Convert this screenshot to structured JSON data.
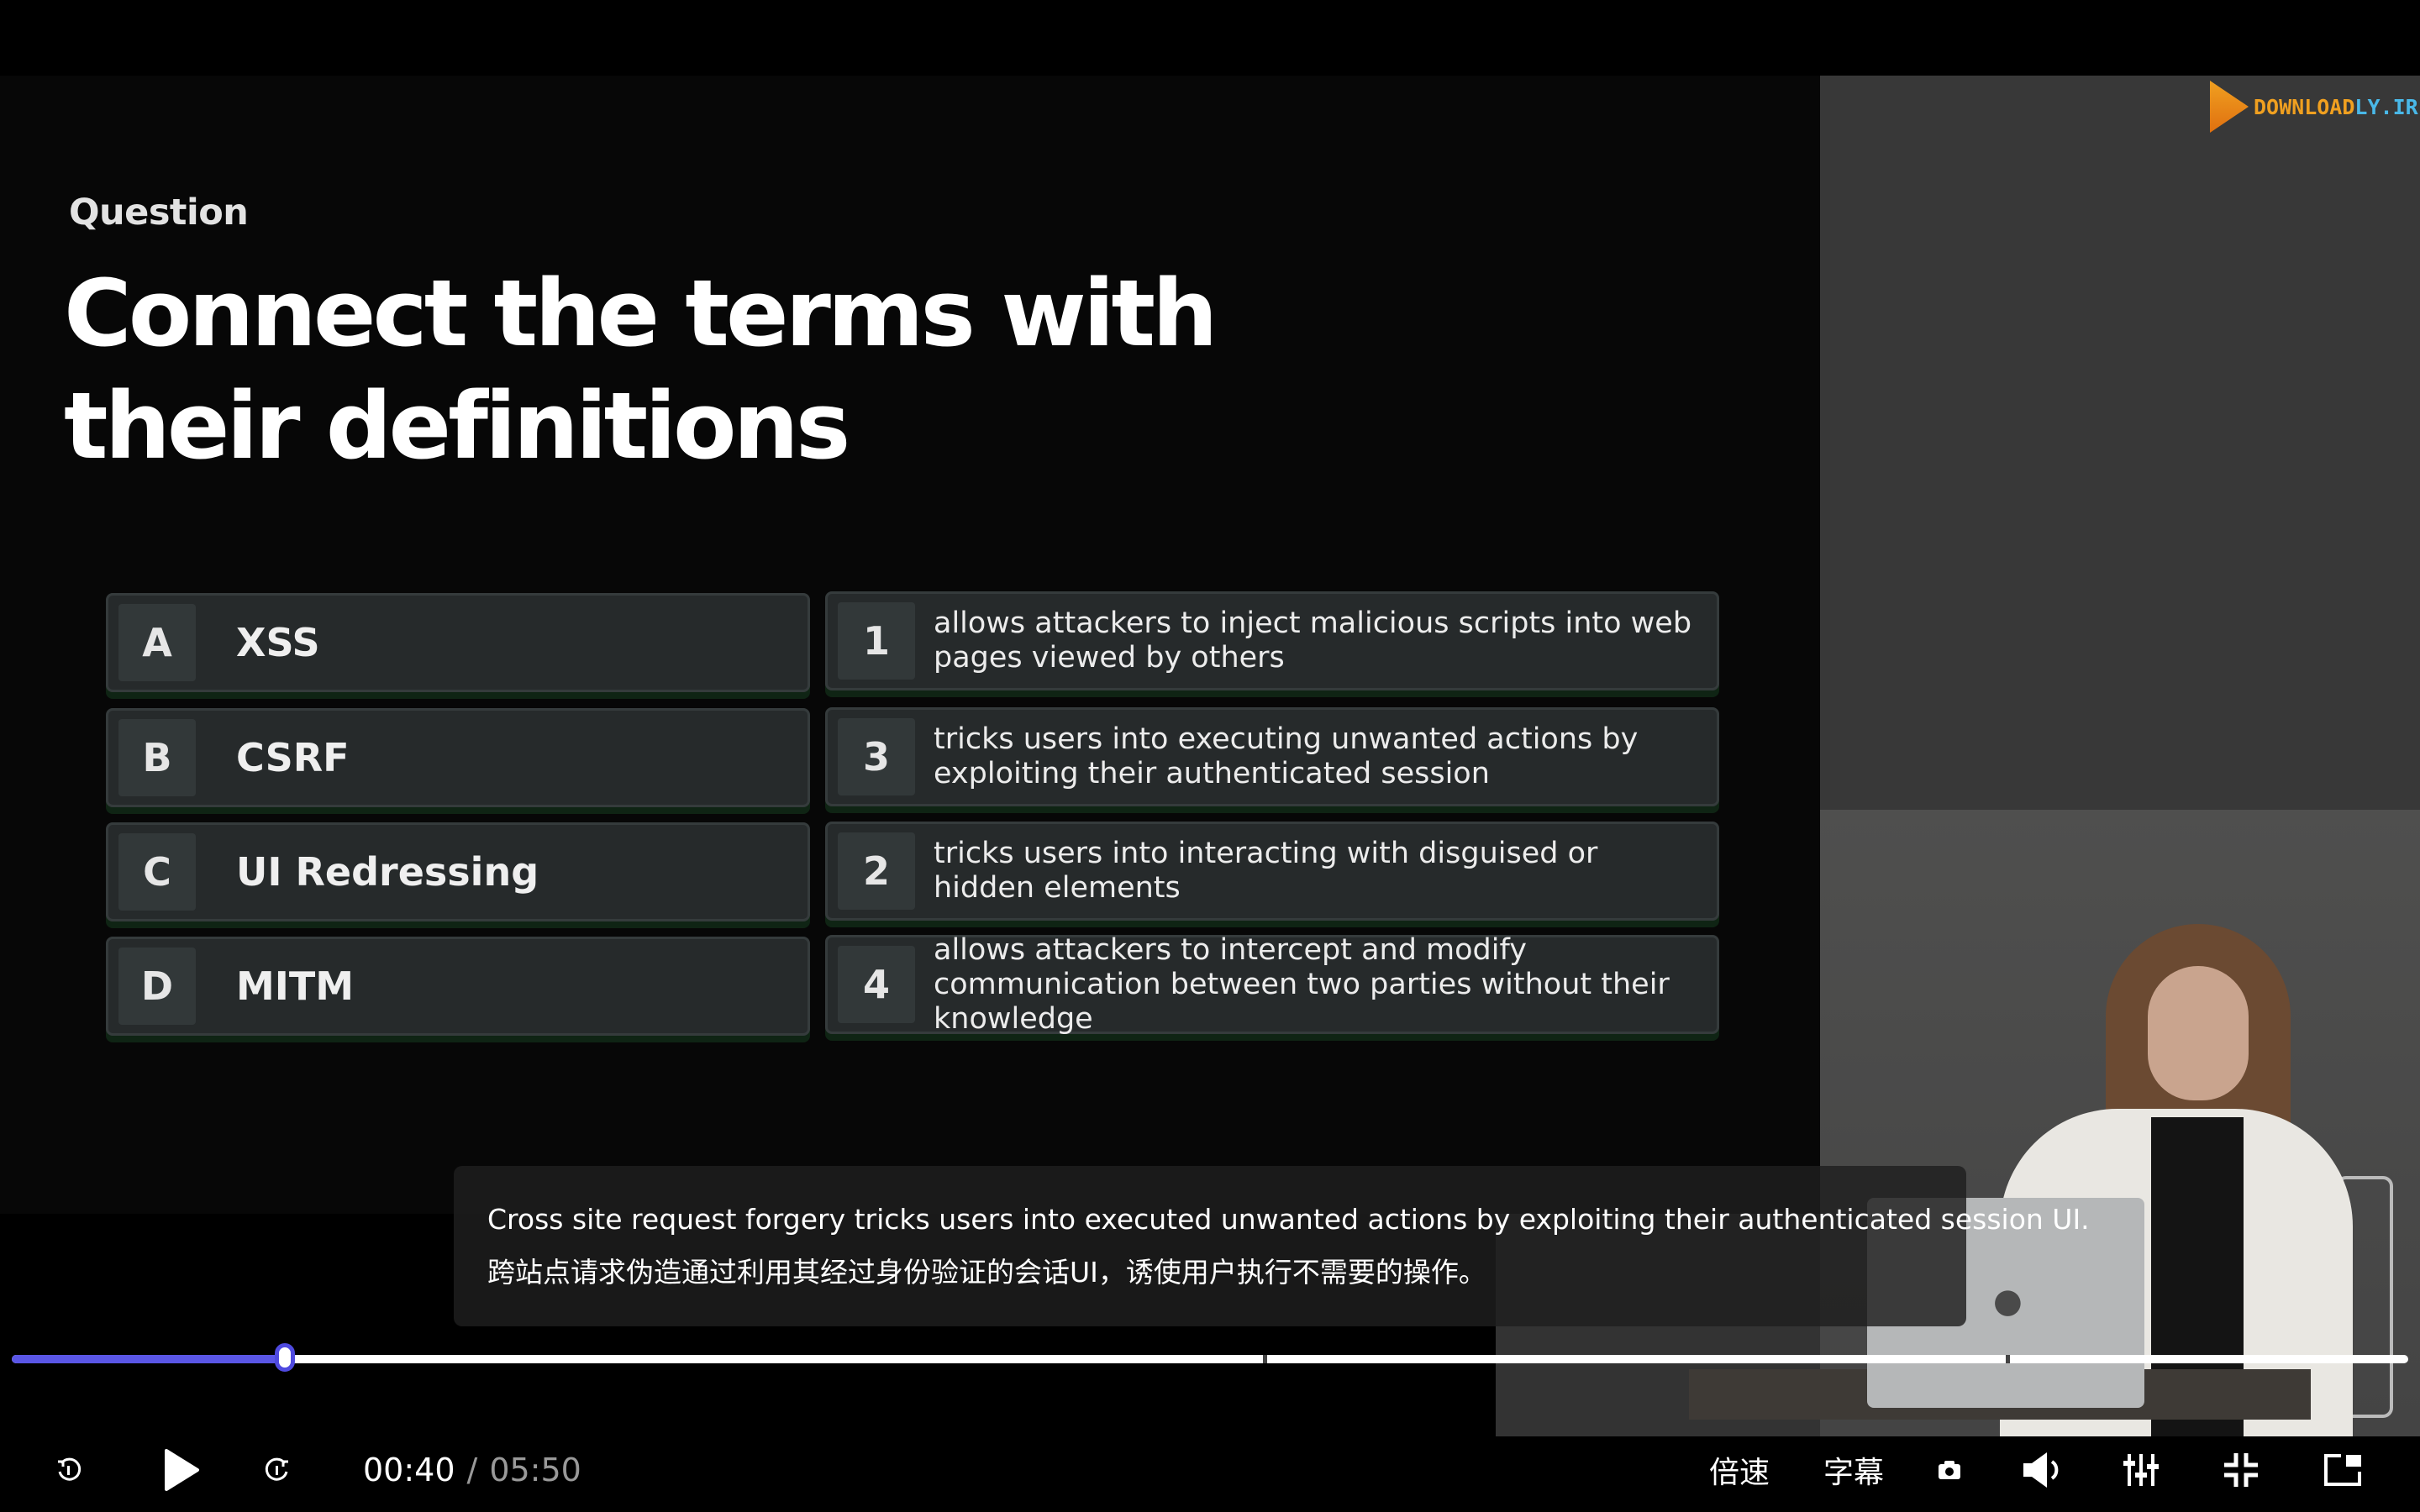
{
  "slide": {
    "label": "Question",
    "title": "Connect the terms with their definitions",
    "terms": [
      {
        "letter": "A",
        "term": "XSS"
      },
      {
        "letter": "B",
        "term": "CSRF"
      },
      {
        "letter": "C",
        "term": "UI Redressing"
      },
      {
        "letter": "D",
        "term": "MITM"
      }
    ],
    "definitions": [
      {
        "number": "1",
        "text": "allows attackers to inject malicious scripts into web pages viewed by others"
      },
      {
        "number": "3",
        "text": "tricks users into executing unwanted actions by exploiting their authenticated session"
      },
      {
        "number": "2",
        "text": "tricks users into interacting with disguised or hidden elements"
      },
      {
        "number": "4",
        "text": "allows attackers to intercept and modify communication between two parties without their knowledge"
      }
    ]
  },
  "watermark": {
    "main": "DOWNLOAD",
    "suffix": "LY.IR"
  },
  "subtitles": {
    "english": "Cross site request forgery tricks users into executed unwanted actions by exploiting their authenticated session UI.",
    "chinese": "跨站点请求伪造通过利用其经过身份验证的会话UI，诱使用户执行不需要的操作。"
  },
  "player": {
    "current_time": "00:40",
    "separator": "/",
    "duration": "05:50",
    "progress_fraction": 0.114,
    "chapter_marker_fractions": [
      0.522,
      0.832
    ],
    "speed_label": "倍速",
    "subtitle_label": "字幕",
    "accent_color": "#5a56e6",
    "icons": [
      "rewind-icon",
      "play-icon",
      "forward-icon",
      "screenshot-icon",
      "volume-icon",
      "settings-icon",
      "exit-fullscreen-icon",
      "pip-icon"
    ]
  }
}
